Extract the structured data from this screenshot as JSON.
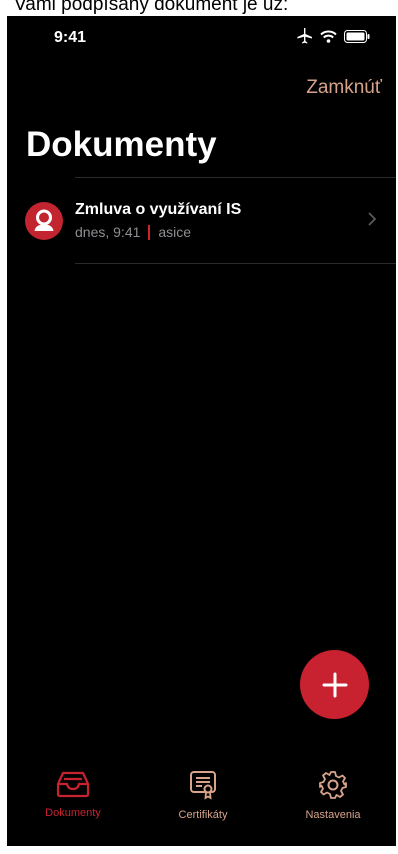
{
  "caption": "Vami podpísaný dokument je uz:",
  "status_bar": {
    "time": "9:41"
  },
  "nav": {
    "lock_label": "Zamknúť"
  },
  "page": {
    "title": "Dokumenty"
  },
  "documents": [
    {
      "name": "Zmluva o využívaní IS",
      "date": "dnes, 9:41",
      "type": "asice"
    }
  ],
  "tabs": [
    {
      "label": "Dokumenty",
      "icon": "tray-icon",
      "active": true
    },
    {
      "label": "Certifikáty",
      "icon": "certificate-icon",
      "active": false
    },
    {
      "label": "Nastavenia",
      "icon": "gear-icon",
      "active": false
    }
  ],
  "colors": {
    "accent": "#c8212f",
    "lock": "#d7a48b",
    "inactive_tab": "#d7a48b"
  }
}
